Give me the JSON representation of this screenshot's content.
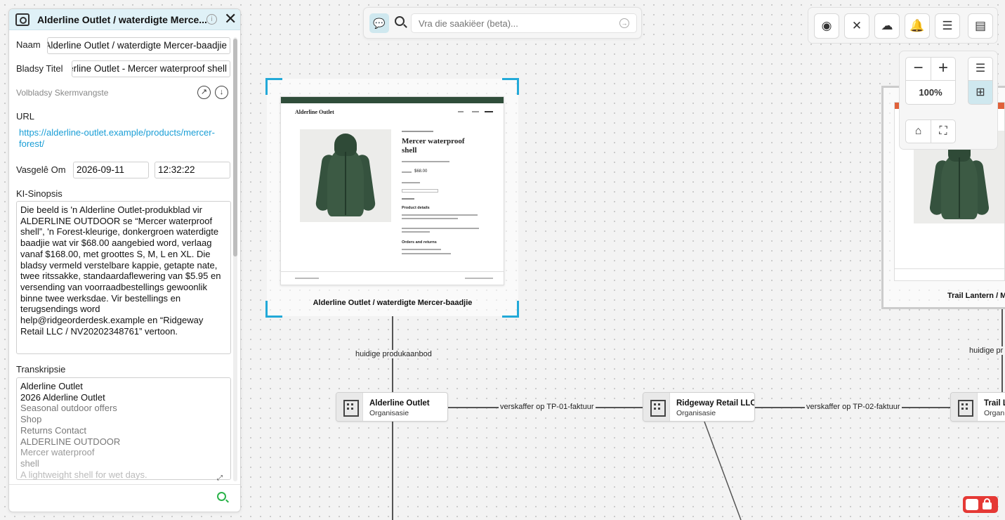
{
  "panel": {
    "title": "Alderline Outlet / waterdigte Merce...",
    "name_label": "Naam",
    "name_value": "Alderline Outlet / waterdigte Mercer-baadjie",
    "page_title_label": "Bladsy Titel",
    "page_title_value": "Alderline Outlet - Mercer waterproof shell",
    "screenshot_label": "Volbladsy Skermvangste",
    "url_label": "URL",
    "url_value": "https://alderline-outlet.example/products/mercer-forest/",
    "captured_label": "Vasgelê Om",
    "captured_date": "2026-09-11",
    "captured_time": "12:32:22",
    "synopsis_label": "KI-Sinopsis",
    "synopsis_text": "Die beeld is 'n Alderline Outlet-produkblad vir ALDERLINE OUTDOOR se “Mercer waterproof shell”, 'n Forest-kleurige, donkergroen waterdigte baadjie wat vir $68.00 aangebied word, verlaag vanaf $168.00, met groottes S, M, L en XL. Die bladsy vermeld verstelbare kappie, getapte nate, twee ritssakke, standaardaflewering van $5.95 en versending van voorraadbestellings gewoonlik binne twee werksdae. Vir bestellings en terugsendings word help@ridgeorderdesk.example en “Ridgeway Retail LLC / NV20202348761” vertoon.",
    "transcript_label": "Transkripsie",
    "transcript_lines": [
      "Alderline Outlet",
      "2026 Alderline Outlet",
      "Seasonal outdoor offers",
      "Shop",
      "Returns Contact",
      "ALDERLINE OUTDOOR",
      "Mercer waterproof",
      "shell",
      "A lightweight shell for wet days."
    ]
  },
  "search": {
    "placeholder": "Vra die saakiëer (beta)..."
  },
  "toolbar": {
    "zoom_level": "100%"
  },
  "canvas": {
    "preview_node_label": "Alderline Outlet / waterdigte Mercer-baadjie",
    "preview_node2_label": "Trail Lantern / Me",
    "preview": {
      "brand": "Alderline Outlet",
      "product_title_1": "Mercer waterproof",
      "product_title_2": "shell",
      "price": "$68.00",
      "details_heading": "Product details",
      "orders_heading": "Orders and returns"
    },
    "edges": {
      "current_offer": "huidige produkaanbod",
      "current_offer_2": "huidige pr",
      "supplier_tp01": "verskaffer op TP-01-faktuur",
      "supplier_tp02": "verskaffer op TP-02-faktuur"
    },
    "nodes": [
      {
        "title": "Alderline Outlet",
        "subtitle": "Organisasie"
      },
      {
        "title": "Ridgeway Retail LLC",
        "subtitle": "Organisasie"
      },
      {
        "title": "Trail L",
        "subtitle": "Organ"
      }
    ]
  },
  "colors": {
    "accent": "#22a9d8",
    "link": "#1a9ed6",
    "header_bg": "#dff1f7",
    "lock": "#e53935"
  }
}
